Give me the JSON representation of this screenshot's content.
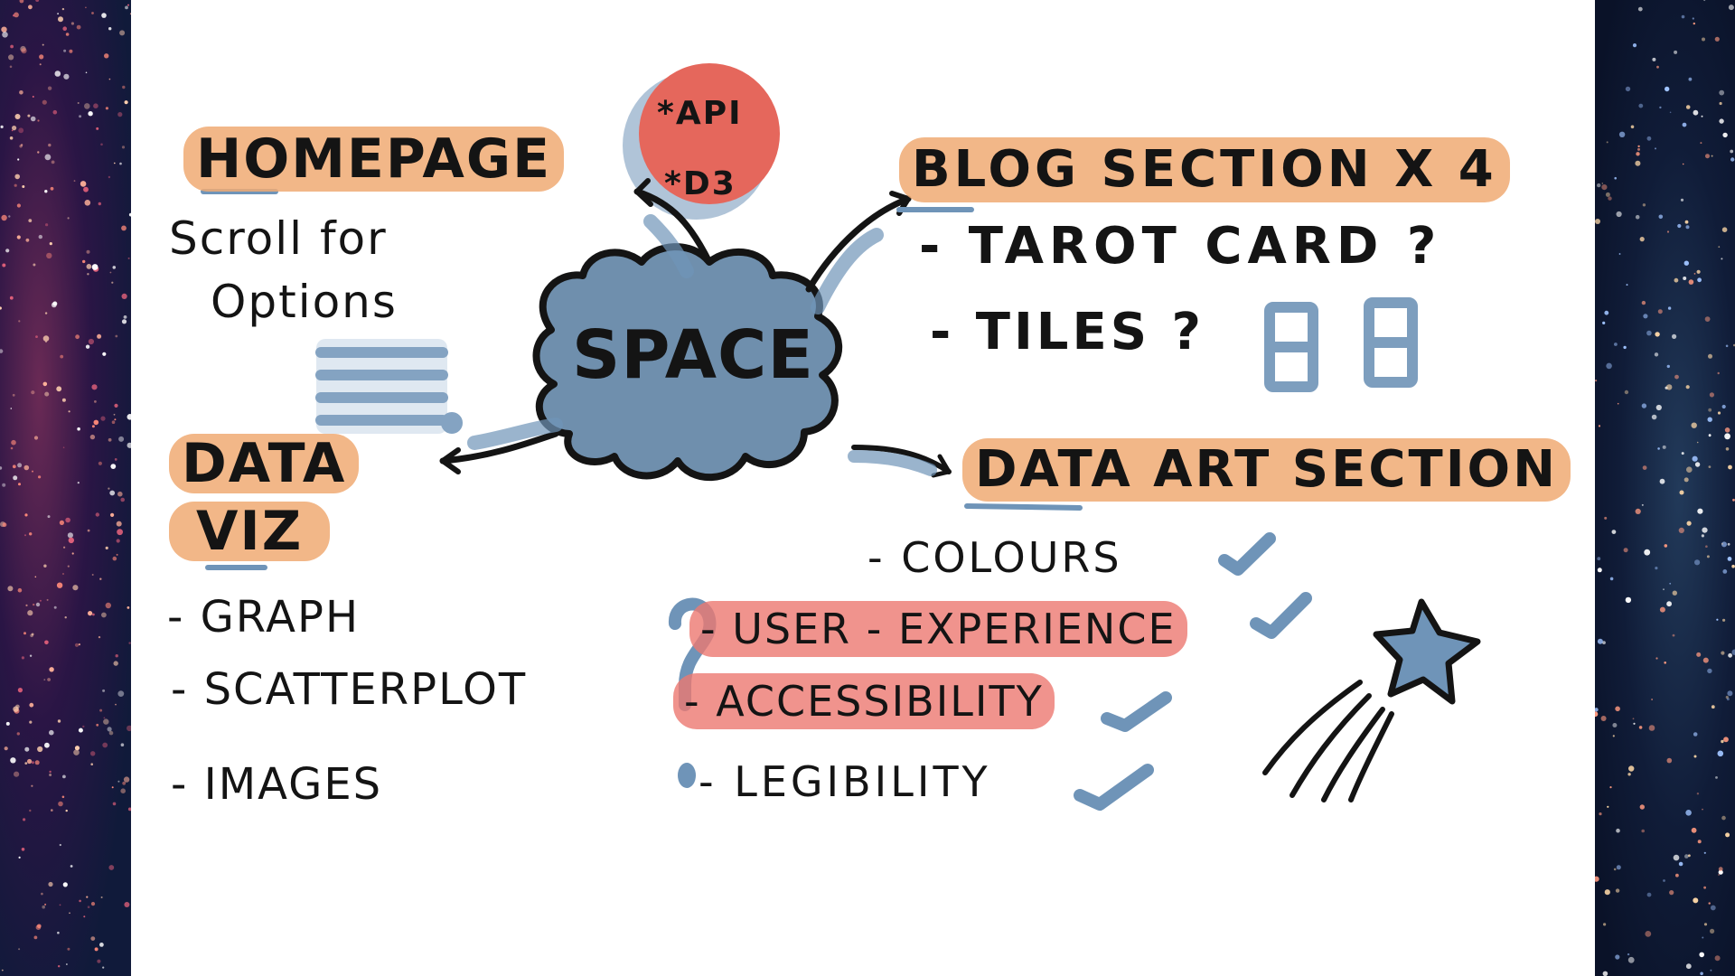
{
  "center": {
    "label": "SPACE"
  },
  "badge": {
    "line1": "*API",
    "line2": "*D3"
  },
  "homepage": {
    "title": "HOMEPAGE",
    "note_line1": "Scroll for",
    "note_line2": "Options"
  },
  "blog": {
    "title": "BLOG SECTION X 4",
    "items": [
      "- TAROT CARD ?",
      "- TILES ?"
    ]
  },
  "dataviz": {
    "title_line1": "DATA",
    "title_line2": "VIZ",
    "items": [
      "- GRAPH",
      "- SCATTERPLOT",
      "- IMAGES"
    ],
    "question": "?"
  },
  "dataart": {
    "title": "DATA ART SECTION",
    "items": [
      "- COLOURS",
      "- USER - EXPERIENCE",
      "- ACCESSIBILITY",
      "- LEGIBILITY"
    ]
  },
  "colors": {
    "cloud": "#6f8fad",
    "accent_blue": "#6f94b8",
    "highlight_orange": "#f0aa73",
    "highlight_red": "#ec7870",
    "badge_red": "#e5675c",
    "ink": "#141414"
  },
  "icons": [
    "checkmark-icon",
    "star-icon",
    "tile-icon",
    "list-icon",
    "arrow-icon"
  ]
}
